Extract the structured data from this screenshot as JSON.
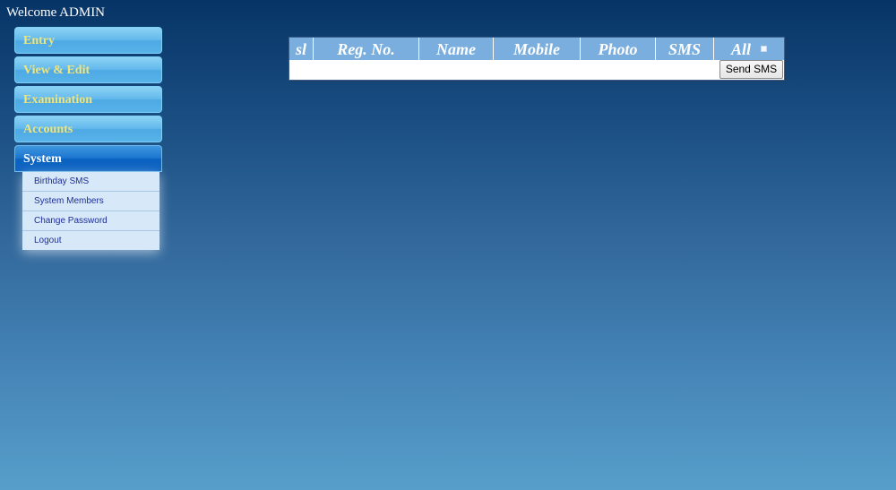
{
  "header": {
    "welcome_text": "Welcome ADMIN"
  },
  "menu": {
    "items": [
      {
        "label": "Entry"
      },
      {
        "label": "View & Edit"
      },
      {
        "label": "Examination"
      },
      {
        "label": "Accounts"
      },
      {
        "label": "System"
      }
    ],
    "active": "System",
    "submenu": [
      {
        "label": "Birthday SMS"
      },
      {
        "label": "System Members"
      },
      {
        "label": "Change Password"
      },
      {
        "label": "Logout"
      }
    ]
  },
  "table": {
    "columns": [
      "sl",
      "Reg. No.",
      "Name",
      "Mobile",
      "Photo",
      "SMS",
      "All"
    ],
    "send_button_label": "Send SMS"
  },
  "colors": {
    "menu_label": "#f1e479",
    "active_menu_label": "#ffffff",
    "table_header_bg": "#7aaede",
    "submenu_text": "#1d2d9a"
  }
}
